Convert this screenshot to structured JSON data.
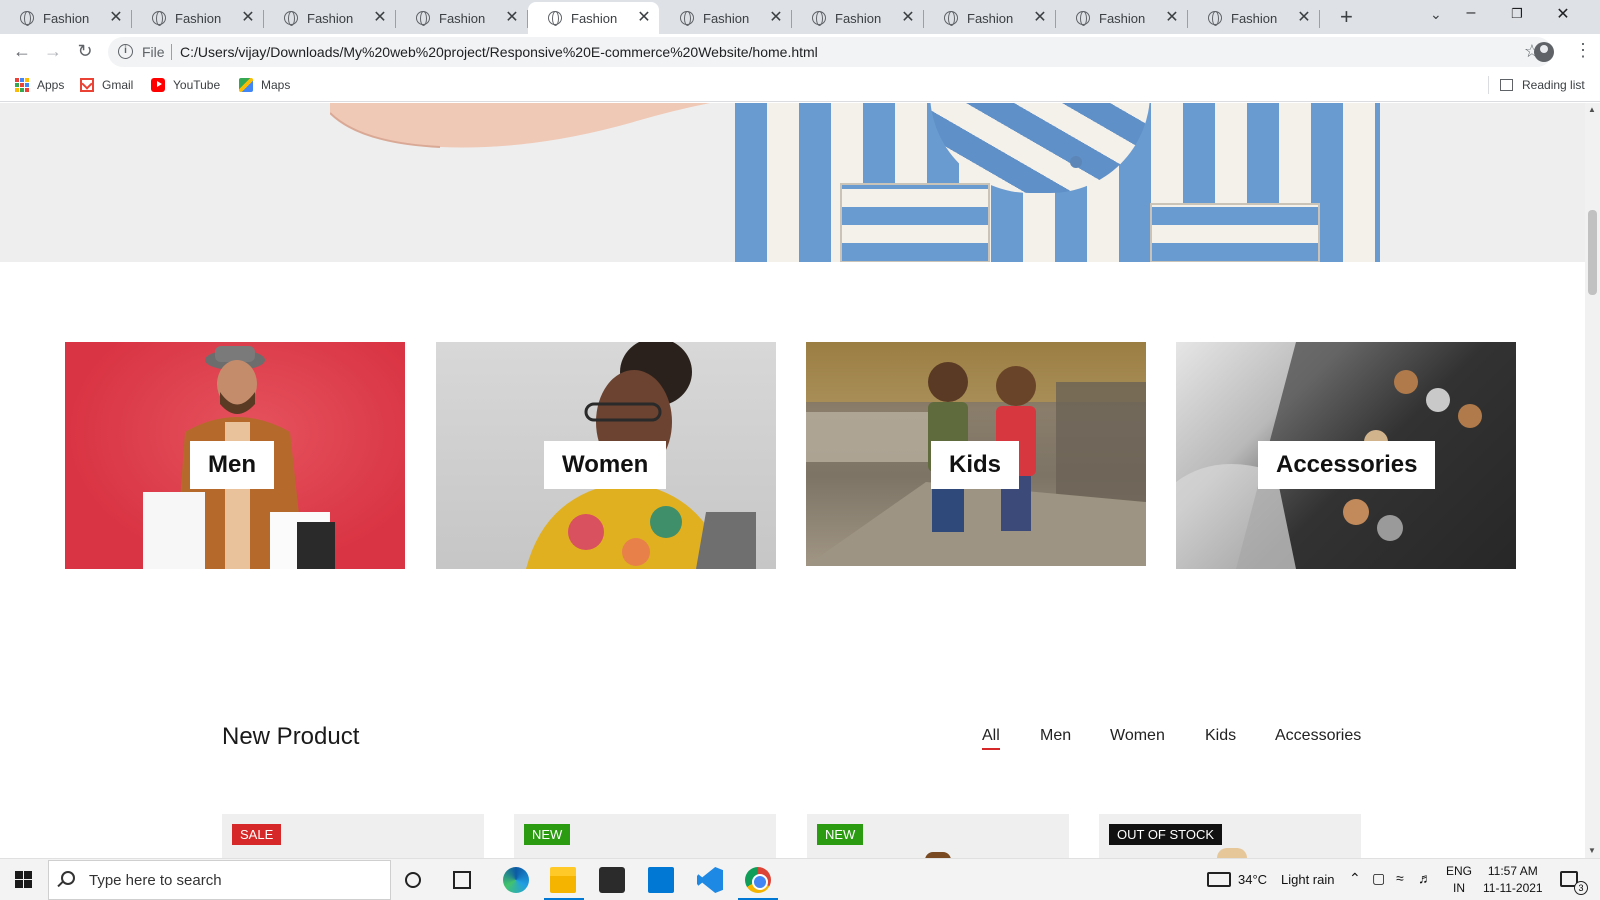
{
  "browser": {
    "tabs": [
      {
        "title": "Fashion",
        "active": false
      },
      {
        "title": "Fashion",
        "active": false
      },
      {
        "title": "Fashion",
        "active": false
      },
      {
        "title": "Fashion",
        "active": false
      },
      {
        "title": "Fashion",
        "active": true
      },
      {
        "title": "Fashion",
        "active": false
      },
      {
        "title": "Fashion",
        "active": false
      },
      {
        "title": "Fashion",
        "active": false
      },
      {
        "title": "Fashion",
        "active": false
      },
      {
        "title": "Fashion",
        "active": false
      }
    ],
    "tab_close_glyph": "✕",
    "new_tab_glyph": "+",
    "address": {
      "scheme_label": "File",
      "url": "C:/Users/vijay/Downloads/My%20web%20project/Responsive%20E-commerce%20Website/home.html"
    },
    "bookmarks": [
      {
        "label": "Apps",
        "icon": "apps-grid-icon"
      },
      {
        "label": "Gmail",
        "icon": "gmail-icon"
      },
      {
        "label": "YouTube",
        "icon": "youtube-icon"
      },
      {
        "label": "Maps",
        "icon": "maps-icon"
      }
    ],
    "reading_list_label": "Reading list"
  },
  "page": {
    "categories": [
      {
        "label": "Men"
      },
      {
        "label": "Women"
      },
      {
        "label": "Kids"
      },
      {
        "label": "Accessories"
      }
    ],
    "new_product": {
      "title": "New Product",
      "filters": [
        "All",
        "Men",
        "Women",
        "Kids",
        "Accessories"
      ],
      "active_filter": "All",
      "products": [
        {
          "badge": "SALE"
        },
        {
          "badge": "NEW"
        },
        {
          "badge": "NEW"
        },
        {
          "badge": "OUT OF STOCK"
        }
      ]
    },
    "colors": {
      "accent_red": "#d62828",
      "badge_new": "#2b9b12",
      "badge_oos": "#111111"
    }
  },
  "taskbar": {
    "search_placeholder": "Type here to search",
    "weather_temp": "34°C",
    "weather_text": "Light rain",
    "lang_top": "ENG",
    "lang_bottom": "IN",
    "time": "11:57 AM",
    "date": "11-11-2021",
    "notification_count": "3"
  }
}
